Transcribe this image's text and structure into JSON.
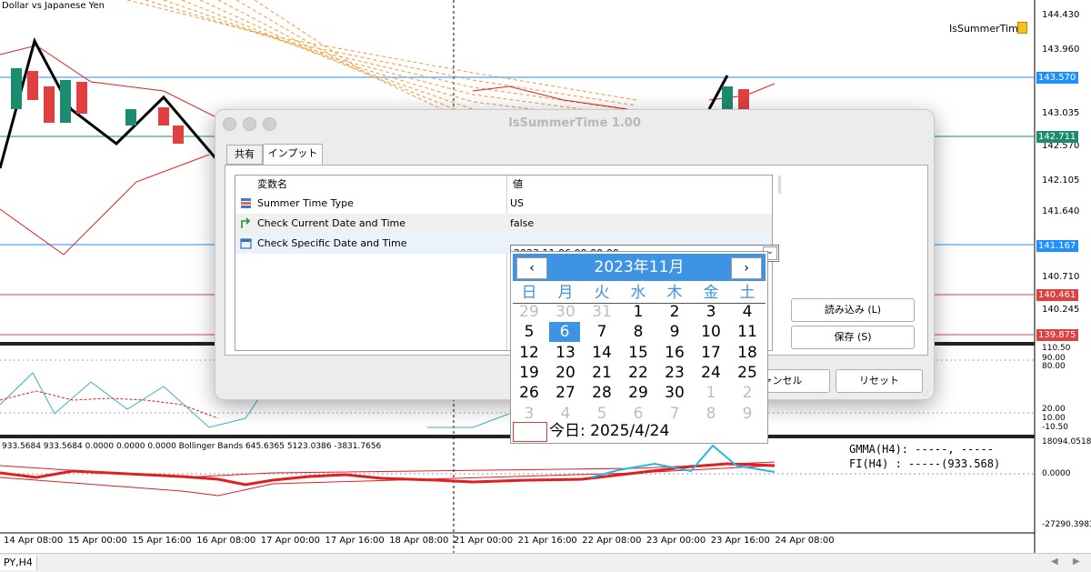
{
  "chart": {
    "symbol_title": "Dollar vs Japanese Yen",
    "indicator_label": "IsSummerTime",
    "price_levels": [
      "144.430",
      "143.960",
      "143.035",
      "142.570",
      "142.105",
      "141.640",
      "140.710",
      "140.245"
    ],
    "price_tags": {
      "tag1": {
        "text": "143.570",
        "color": "#1e90ff"
      },
      "tag2": {
        "text": "142.711",
        "color": "#1c8c6e"
      },
      "tag3": {
        "text": "141.167",
        "color": "#1e90ff"
      },
      "tag4": {
        "text": "140.461",
        "color": "#e04040"
      },
      "tag5": {
        "text": "139.875",
        "color": "#e04040"
      }
    },
    "osc_levels": [
      "110.50",
      "90.00",
      "80.00",
      "20.00",
      "10.00",
      "-10.50"
    ],
    "lower_status": "933.5684 933.5684 0.0000 0.0000 0.0000 Bollinger Bands 645.6365 5123.0386 -3831.7656",
    "gmma_text": "GMMA(H4): -----, -----",
    "fi_text": "FI(H4)  : -----(933.568)",
    "lower_levels": [
      "18094.0518",
      "0.0000",
      "-27290.3983"
    ],
    "time_labels": [
      "14 Apr 08:00",
      "15 Apr 00:00",
      "15 Apr 16:00",
      "16 Apr 08:00",
      "17 Apr 00:00",
      "17 Apr 16:00",
      "18 Apr 08:00",
      "21 Apr 00:00",
      "21 Apr 16:00",
      "22 Apr 08:00",
      "23 Apr 00:00",
      "23 Apr 16:00",
      "24 Apr 08:00"
    ],
    "tab_label": "PY,H4"
  },
  "dialog": {
    "title": "IsSummerTime 1.00",
    "tabs": [
      "共有",
      "インプット"
    ],
    "grid": {
      "col_name": "変数名",
      "col_value": "値",
      "rows": [
        {
          "name": "Summer Time Type",
          "value": "US",
          "icon": "enum-icon"
        },
        {
          "name": "Check Current Date and Time",
          "value": "false",
          "icon": "bool-icon"
        },
        {
          "name": "Check Specific Date and Time",
          "value": "2023.11.06 00:00:00",
          "icon": "calendar-icon"
        }
      ]
    },
    "buttons": {
      "load": "読み込み (L)",
      "save": "保存 (S)",
      "cancel": "キャンセル",
      "reset": "リセット"
    }
  },
  "calendar": {
    "title": "2023年11月",
    "prev": "‹",
    "next": "›",
    "weekdays": [
      "日",
      "月",
      "火",
      "水",
      "木",
      "金",
      "土"
    ],
    "weeks": [
      [
        "29",
        "30",
        "31",
        "1",
        "2",
        "3",
        "4"
      ],
      [
        "5",
        "6",
        "7",
        "8",
        "9",
        "10",
        "11"
      ],
      [
        "12",
        "13",
        "14",
        "15",
        "16",
        "17",
        "18"
      ],
      [
        "19",
        "20",
        "21",
        "22",
        "23",
        "24",
        "25"
      ],
      [
        "26",
        "27",
        "28",
        "29",
        "30",
        "1",
        "2"
      ],
      [
        "3",
        "4",
        "5",
        "6",
        "7",
        "8",
        "9"
      ]
    ],
    "selected_day": "6",
    "today_text": "今日: 2025/4/24"
  }
}
